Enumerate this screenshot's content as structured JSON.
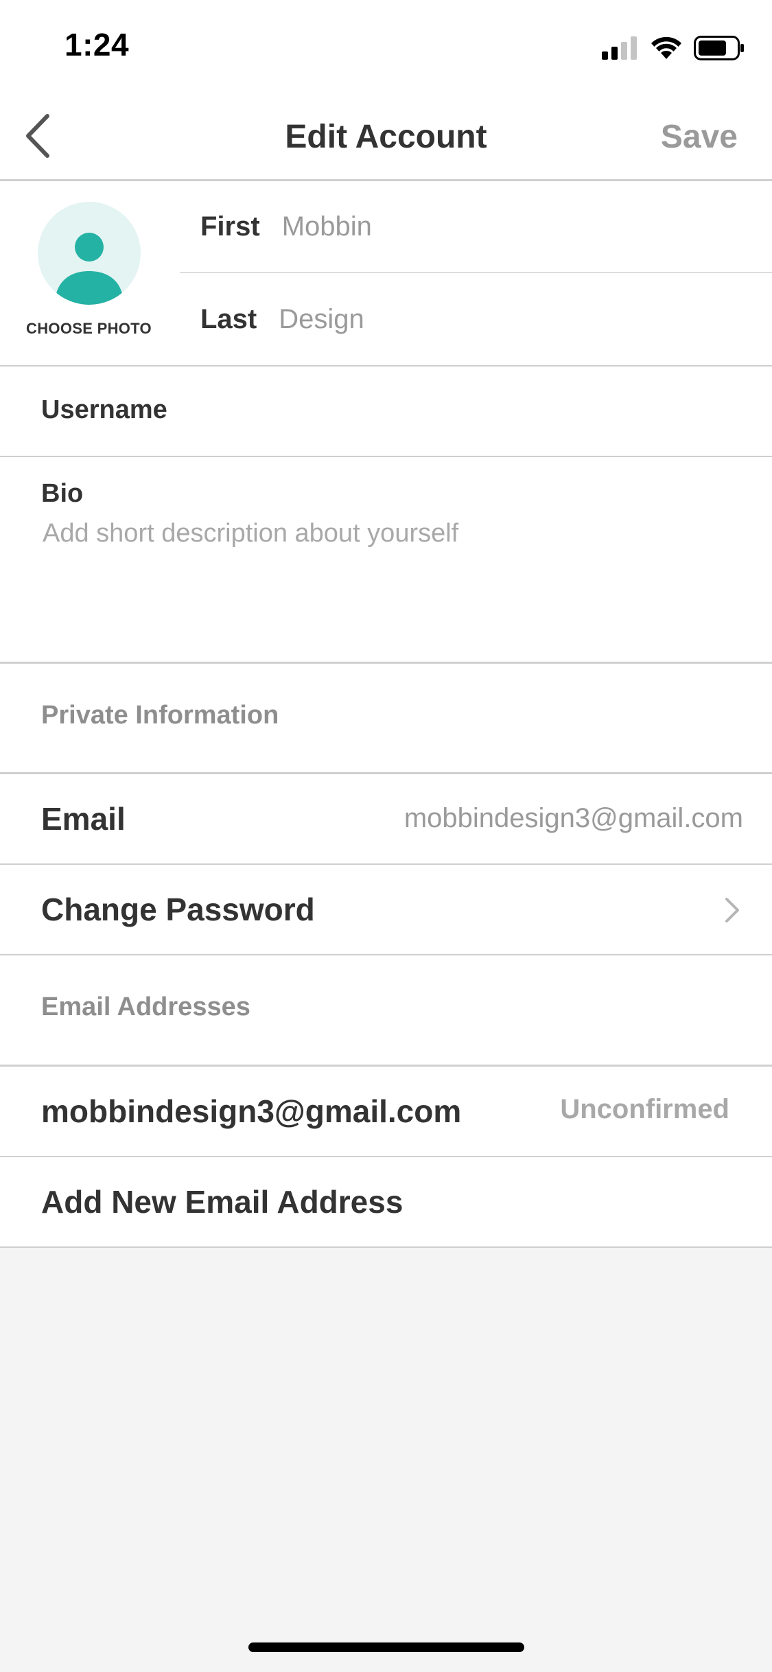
{
  "status_bar": {
    "time": "1:24",
    "icons": [
      "cellular-signal-icon",
      "wifi-icon",
      "battery-icon"
    ]
  },
  "nav": {
    "back_icon": "chevron-left-icon",
    "title": "Edit Account",
    "save_label": "Save"
  },
  "profile": {
    "avatar_icon": "person-icon",
    "choose_photo_label": "CHOOSE PHOTO",
    "first_label": "First",
    "first_value": "Mobbin",
    "last_label": "Last",
    "last_value": "Design"
  },
  "username": {
    "label": "Username"
  },
  "bio": {
    "label": "Bio",
    "placeholder": "Add short description about yourself"
  },
  "private_section": {
    "header": "Private Information",
    "email_label": "Email",
    "email_value": "mobbindesign3@gmail.com",
    "change_password_label": "Change Password",
    "chevron_icon": "chevron-right-icon"
  },
  "email_addresses": {
    "header": "Email Addresses",
    "items": [
      {
        "address": "mobbindesign3@gmail.com",
        "status": "Unconfirmed"
      }
    ],
    "add_label": "Add New Email Address"
  },
  "colors": {
    "accent": "#24b2a4",
    "avatar_bg": "#e4f4f3",
    "muted_text": "#9a9a9a",
    "page_bg": "#f4f4f4"
  }
}
